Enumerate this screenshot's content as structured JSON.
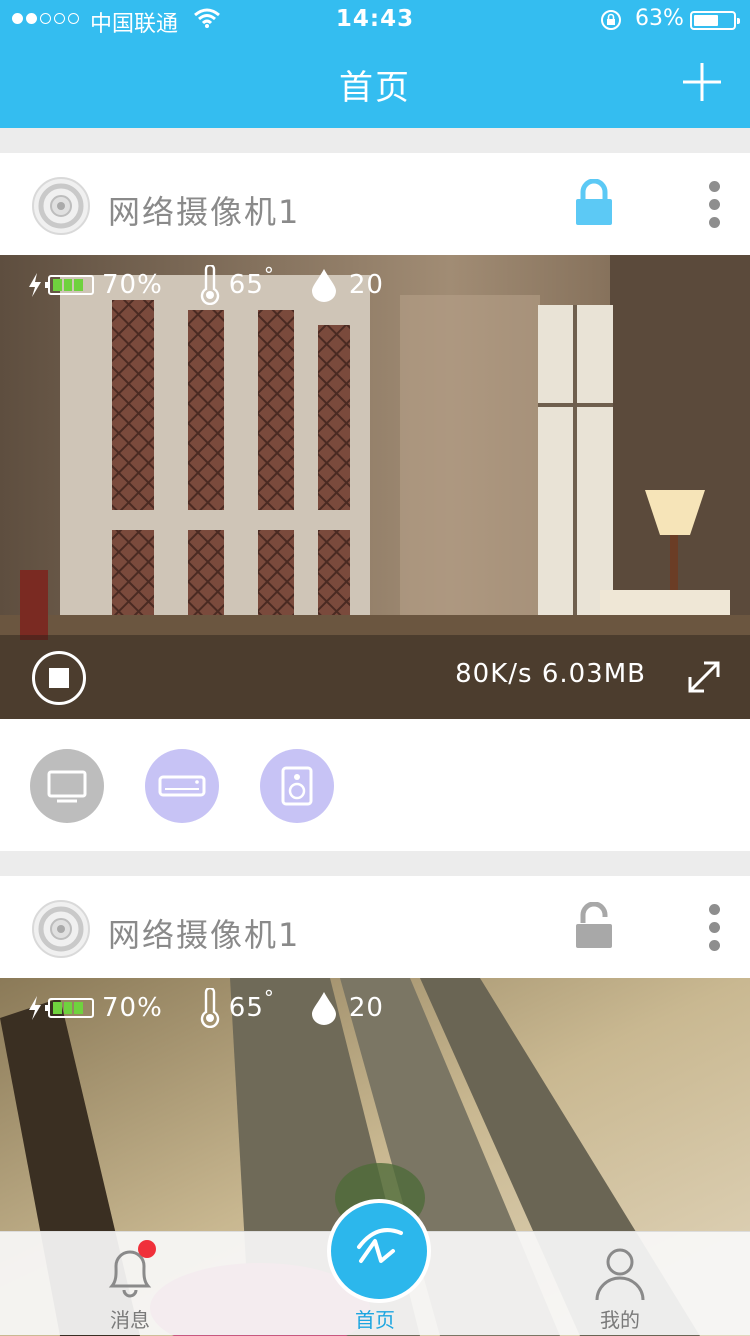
{
  "status_bar": {
    "carrier": "中国联通",
    "time": "14:43",
    "battery_percent": "63%",
    "battery_level": 0.63,
    "signal_dots_filled": 2,
    "signal_dots_total": 5
  },
  "nav": {
    "title": "首页",
    "add_icon": "plus-icon"
  },
  "colors": {
    "accent": "#34bdf0",
    "lock_locked": "#5cc9f5",
    "lock_unlocked": "#a8a8a8",
    "device_tv": "#bdbdbd",
    "device_ac": "#c7c3f5",
    "device_speaker": "#c7c3f5",
    "badge": "#f0303a"
  },
  "cameras": [
    {
      "name": "网络摄像机1",
      "lock_state": "locked",
      "stats": {
        "battery": "70%",
        "temperature": "65",
        "temp_unit": "°",
        "humidity": "20"
      },
      "stream": {
        "rate": "80K/s 6.03MB"
      },
      "devices": [
        "tv-icon",
        "air-conditioner-icon",
        "speaker-icon"
      ]
    },
    {
      "name": "网络摄像机1",
      "lock_state": "unlocked",
      "stats": {
        "battery": "70%",
        "temperature": "65",
        "temp_unit": "°",
        "humidity": "20"
      }
    }
  ],
  "tabbar": {
    "tabs": [
      {
        "label": "消息",
        "icon": "bell-icon",
        "badge": true
      },
      {
        "label": "首页",
        "icon": "home-logo-icon",
        "active": true
      },
      {
        "label": "我的",
        "icon": "user-icon"
      }
    ]
  }
}
